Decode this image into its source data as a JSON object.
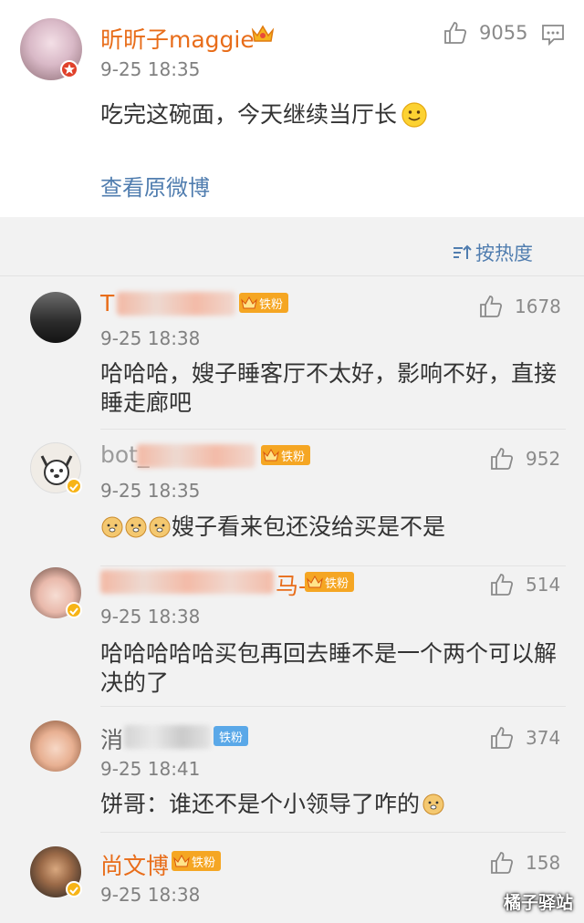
{
  "post": {
    "author": "昕昕子maggie",
    "time": "9-25 18:35",
    "likes": "9055",
    "text": "吃完这碗面，今天继续当厅长",
    "view_original": "查看原微博"
  },
  "sort_label": "按热度",
  "comments": [
    {
      "name": "T",
      "time": "9-25 18:38",
      "likes": "1678",
      "text_line1": "哈哈哈，嫂子睡客厅不太好，影响不好，直接",
      "text_line2": "睡走廊吧",
      "fan": "铁粉"
    },
    {
      "name": "bot_",
      "time": "9-25 18:35",
      "likes": "952",
      "text_line1": "嫂子看来包还没给买是不是",
      "text_line2": "",
      "fan": "铁粉"
    },
    {
      "name": "马-",
      "time": "9-25 18:38",
      "likes": "514",
      "text_line1": "哈哈哈哈哈买包再回去睡不是一个两个可以解",
      "text_line2": "决的了",
      "fan": "铁粉"
    },
    {
      "name": "消",
      "time": "9-25 18:41",
      "likes": "374",
      "text_line1": "饼哥：谁还不是个小领导了咋的",
      "text_line2": "",
      "fan": "铁粉"
    },
    {
      "name": "尚文博",
      "time": "9-25 18:38",
      "likes": "158",
      "text_line1": "",
      "text_line2": "",
      "fan": "铁粉"
    }
  ],
  "watermark": "橘子驿站",
  "colors": {
    "name": "#e86d1a",
    "link": "#507daf",
    "fan_orange": "#f5a623",
    "fan_blue": "#5aa8e8"
  }
}
